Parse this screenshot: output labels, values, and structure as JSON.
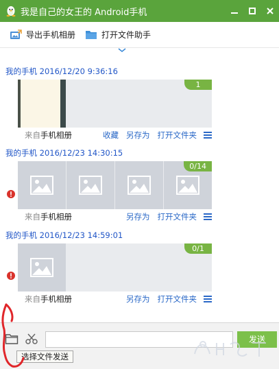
{
  "window": {
    "title": "我是自己的女王的 Android手机",
    "accent": "#5aa43c",
    "controls": [
      "minimize-icon",
      "maximize-icon",
      "close-icon"
    ]
  },
  "toolbar": {
    "export_label": "导出手机相册",
    "open_assistant_label": "打开文件助手"
  },
  "messages": [
    {
      "sender": "我的手机 2016/12/20 9:36:16",
      "count": "1",
      "source_prefix": "来自",
      "source": "手机相册",
      "actions": [
        "收藏",
        "另存为",
        "打开文件夹"
      ],
      "failed": false
    },
    {
      "sender": "我的手机 2016/12/23 14:30:15",
      "count": "0/14",
      "source_prefix": "来自",
      "source": "手机相册",
      "actions": [
        "另存为",
        "打开文件夹"
      ],
      "failed": true
    },
    {
      "sender": "我的手机 2016/12/23 14:59:01",
      "count": "0/1",
      "source_prefix": "来自",
      "source": "手机相册",
      "actions": [
        "另存为",
        "打开文件夹"
      ],
      "failed": true
    }
  ],
  "input": {
    "value": "",
    "placeholder": "",
    "send_label": "发送",
    "tooltip": "选择文件发送"
  },
  "colors": {
    "link": "#2a68c7",
    "sender": "#2156c7",
    "badge": "#78b443",
    "send": "#7cc04a",
    "error": "#d9322b",
    "annotation": "#e0262a"
  }
}
